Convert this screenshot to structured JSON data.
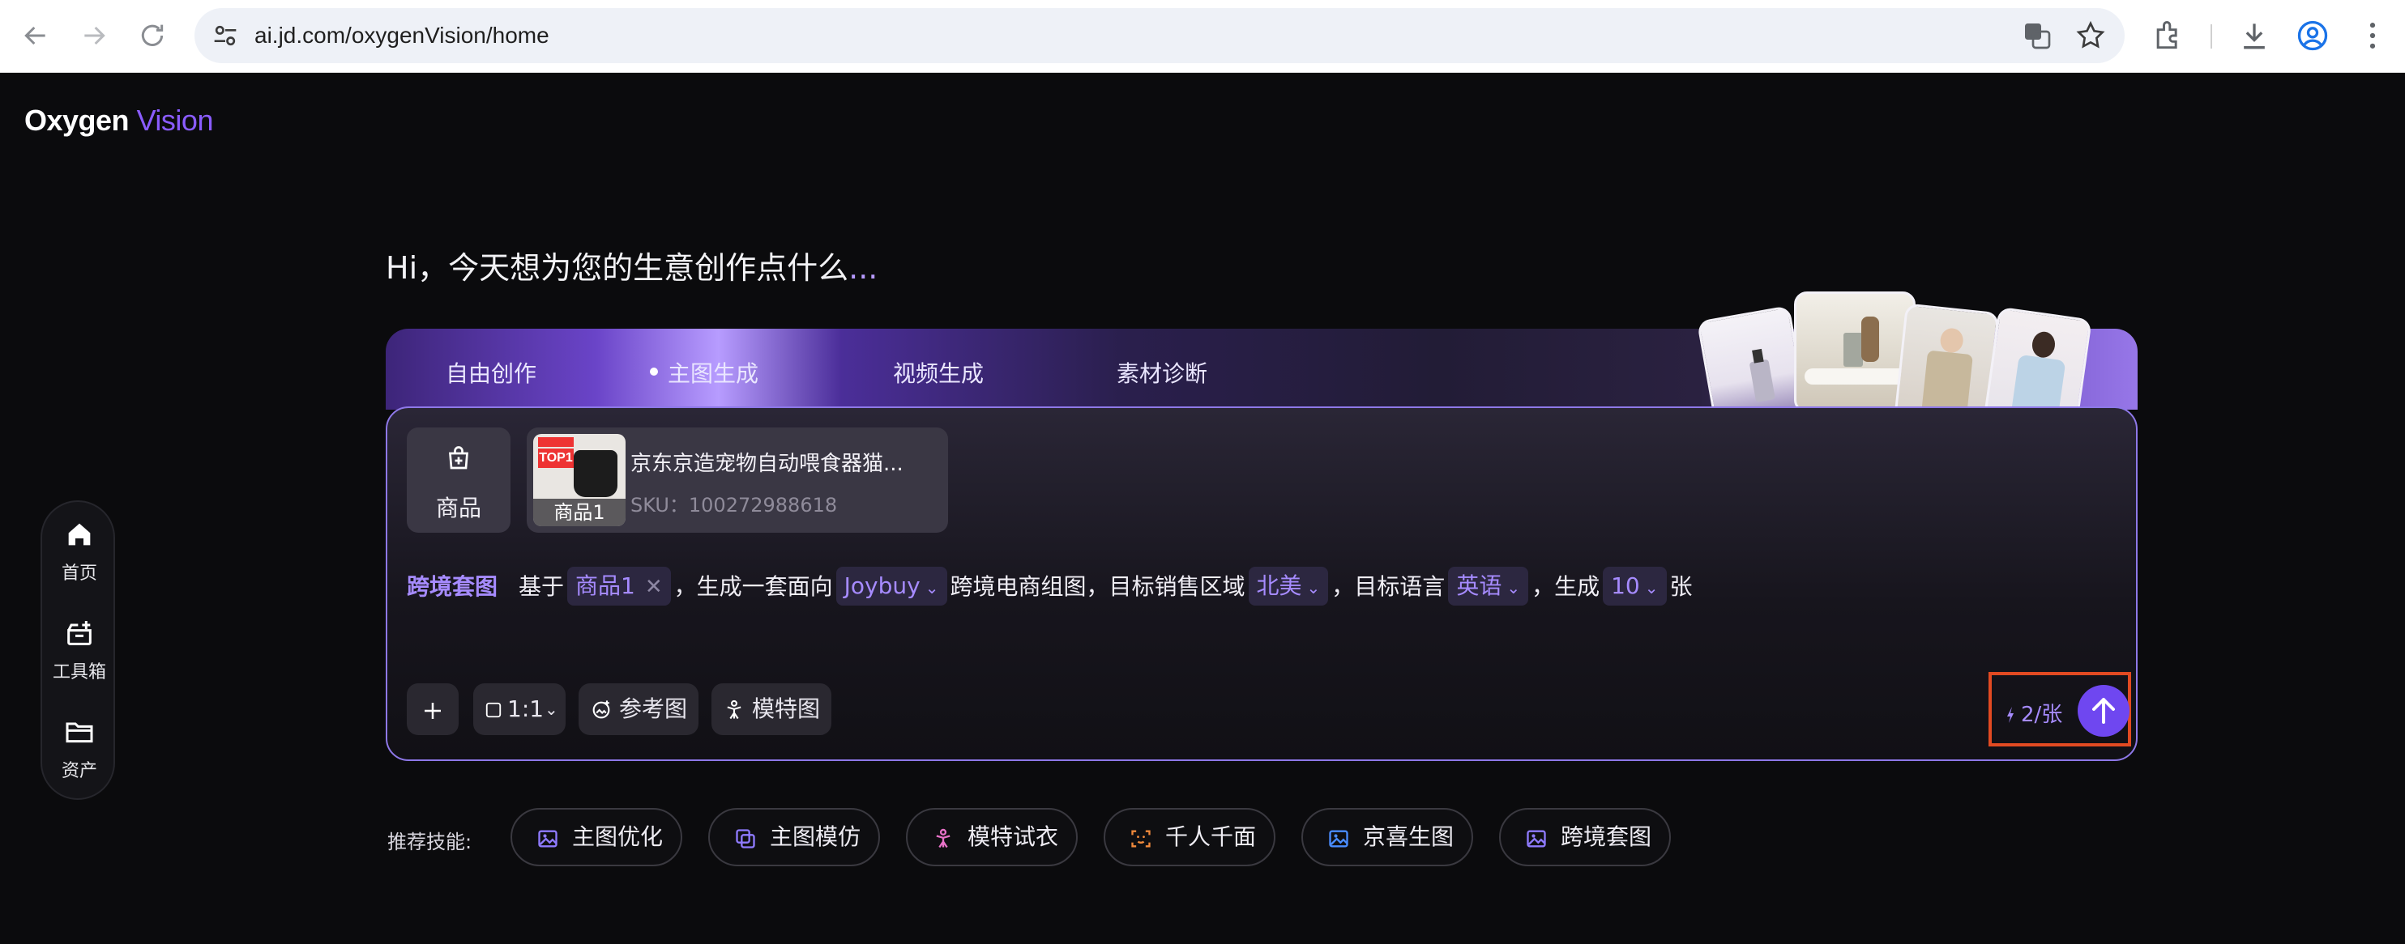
{
  "browser": {
    "url": "ai.jd.com/oxygenVision/home"
  },
  "app": {
    "logo_primary": "Oxygen",
    "logo_secondary": "Vision"
  },
  "sidebar": {
    "items": [
      {
        "label": "首页",
        "icon": "home-icon"
      },
      {
        "label": "工具箱",
        "icon": "toolbox-icon"
      },
      {
        "label": "资产",
        "icon": "folder-icon"
      }
    ]
  },
  "greeting": {
    "text": "Hi，今天想为您的生意创作点什么",
    "dots": "..."
  },
  "tabs": [
    {
      "label": "自由创作"
    },
    {
      "label": "主图生成",
      "active": true
    },
    {
      "label": "视频生成"
    },
    {
      "label": "素材诊断"
    }
  ],
  "composer": {
    "product_button_label": "商品",
    "product": {
      "name": "京东京造宠物自动喂食器猫...",
      "sku": "SKU：100272988618",
      "tag": "商品1"
    },
    "prompt": {
      "keyword": "跨境套图",
      "t1": "基于",
      "product_chip": "商品1",
      "t2": "，生成一套面向",
      "platform": "Joybuy",
      "t3": "跨境电商组图，目标销售区域",
      "region": "北美",
      "t4": "，目标语言",
      "language": "英语",
      "t5": "，生成",
      "count": "10",
      "t6": "张"
    },
    "toolbar": {
      "ratio": "1:1",
      "reference_label": "参考图",
      "model_label": "模特图"
    },
    "credits": "2/张"
  },
  "recommended": {
    "label": "推荐技能:",
    "skills": [
      {
        "label": "主图优化",
        "icon": "image-icon",
        "color": "#8f7bff"
      },
      {
        "label": "主图模仿",
        "icon": "copy-icon",
        "color": "#8f7bff"
      },
      {
        "label": "模特试衣",
        "icon": "model-icon",
        "color": "#e872c8"
      },
      {
        "label": "千人千面",
        "icon": "face-scan-icon",
        "color": "#f08a3c"
      },
      {
        "label": "京喜生图",
        "icon": "image-icon",
        "color": "#4a8dff"
      },
      {
        "label": "跨境套图",
        "icon": "image-icon",
        "color": "#8f7bff"
      }
    ]
  },
  "colors": {
    "accent": "#8a5cff",
    "send_button": "#6f47f0",
    "highlight_box": "#e24a22"
  }
}
